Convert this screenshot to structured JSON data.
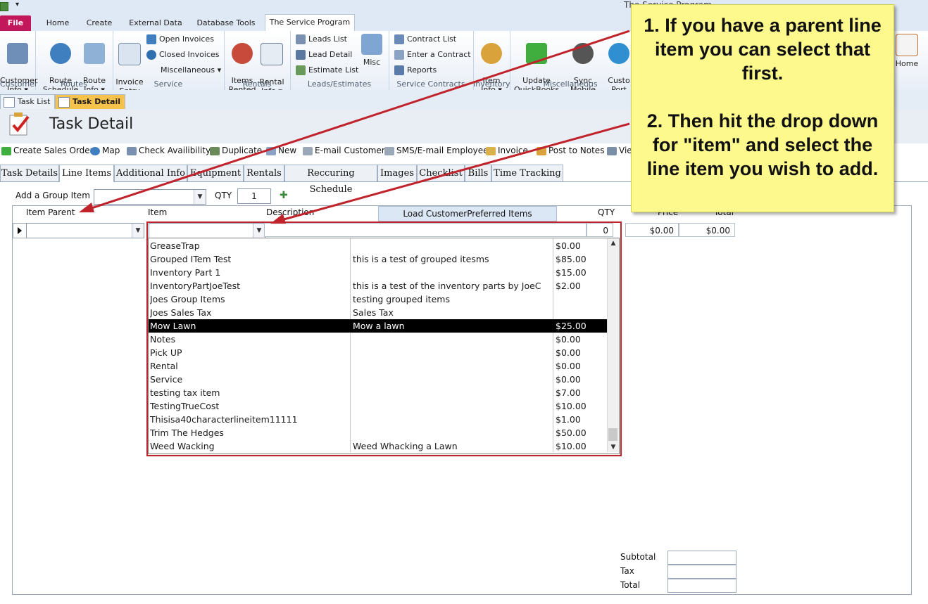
{
  "window": {
    "title": "The Service Program"
  },
  "ribbon_tabs": [
    "File",
    "Home",
    "Create",
    "External Data",
    "Database Tools",
    "The Service Program"
  ],
  "ribbon_groups": {
    "customer": {
      "label": "Customer",
      "btn": "Customer\nInfo ▾"
    },
    "routes": {
      "label": "Routes",
      "btn1": "Route\nSchedule",
      "btn2": "Route\nInfo ▾"
    },
    "service": {
      "label": "Service",
      "btn1": "Invoice\nEntry",
      "open": "Open Invoices",
      "closed": "Closed Invoices",
      "misc": "Miscellaneous ▾"
    },
    "rentals": {
      "label": "Rentals",
      "btn1": "Items\nRented",
      "btn2": "Rental\nInfo ▾"
    },
    "leads": {
      "label": "Leads/Estimates",
      "list": "Leads List",
      "detail": "Lead Detail",
      "estimate": "Estimate List",
      "misc": "Misc"
    },
    "contracts": {
      "label": "Service Contracts",
      "list": "Contract List",
      "enter": "Enter a Contract",
      "reports": "Reports"
    },
    "inventory": {
      "label": "Inventory",
      "btn1": "Item\nInfo ▾"
    },
    "miscellaneous": {
      "label": "Miscellaneous",
      "btn1": "Update\nQuickBooks",
      "btn2": "Sync Mobile\nDevices",
      "btn3": "Custo\nPort"
    },
    "home": {
      "btn": "Home"
    }
  },
  "doc_tabs": [
    "Task List",
    "Task Detail"
  ],
  "form": {
    "title": "Task Detail"
  },
  "commands": [
    "Create Sales Order",
    "Map",
    "Check Availibility",
    "Duplicate",
    "New",
    "E-mail Customer",
    "SMS/E-mail Employee",
    "Invoice",
    "Post to Notes",
    "Vie"
  ],
  "form_tabs": [
    "Task Details",
    "Line Items",
    "Additional Info",
    "Equipment",
    "Rentals",
    "Reccuring Schedule",
    "Images",
    "Checklist",
    "Bills",
    "Time Tracking"
  ],
  "group_row": {
    "label": "Add a Group Item",
    "qty_label": "QTY",
    "qty_value": "1"
  },
  "columns": {
    "item_parent": "Item Parent",
    "item": "Item",
    "description": "Description",
    "load_btn": "Load CustomerPreferred Items",
    "qty": "QTY",
    "price": "Price",
    "total": "Total"
  },
  "entry_row": {
    "qty": "0",
    "price": "$0.00",
    "total": "$0.00"
  },
  "dropdown_items": [
    {
      "item": "GreaseTrap",
      "desc": "",
      "price": "$0.00"
    },
    {
      "item": "Grouped ITem Test",
      "desc": "this is a test of grouped itesms",
      "price": "$85.00"
    },
    {
      "item": "Inventory Part 1",
      "desc": "",
      "price": "$15.00"
    },
    {
      "item": "InventoryPartJoeTest",
      "desc": "this is a test of the inventory parts by JoeC",
      "price": "$2.00"
    },
    {
      "item": "Joes Group Items",
      "desc": "testing grouped items",
      "price": ""
    },
    {
      "item": "Joes Sales Tax",
      "desc": "Sales Tax",
      "price": ""
    },
    {
      "item": "Mow Lawn",
      "desc": "Mow a lawn",
      "price": "$25.00"
    },
    {
      "item": "Notes",
      "desc": "",
      "price": "$0.00"
    },
    {
      "item": "Pick UP",
      "desc": "",
      "price": "$0.00"
    },
    {
      "item": "Rental",
      "desc": "",
      "price": "$0.00"
    },
    {
      "item": "Service",
      "desc": "",
      "price": "$0.00"
    },
    {
      "item": "testing tax item",
      "desc": "",
      "price": "$7.00"
    },
    {
      "item": "TestingTrueCost",
      "desc": "",
      "price": "$10.00"
    },
    {
      "item": "Thisisa40characterlineitem11111",
      "desc": "",
      "price": "$1.00"
    },
    {
      "item": "Trim The Hedges",
      "desc": "",
      "price": "$50.00"
    },
    {
      "item": "Weed Wacking",
      "desc": "Weed Whacking a Lawn",
      "price": "$10.00"
    }
  ],
  "selected_index": 6,
  "totals": {
    "subtotal": "Subtotal",
    "tax": "Tax",
    "total": "Total"
  },
  "callout": {
    "line1": "1.  If you have a parent line item you can select that first.",
    "line2": "2.  Then hit the drop down for \"item\" and select the line item you wish to add."
  },
  "colors": {
    "file_tab": "#c2185b",
    "active_doc_tab": "#f7c24b",
    "highlight": "#c0232b",
    "callout_bg": "#fdf98c",
    "arrow": "#c0232b"
  }
}
